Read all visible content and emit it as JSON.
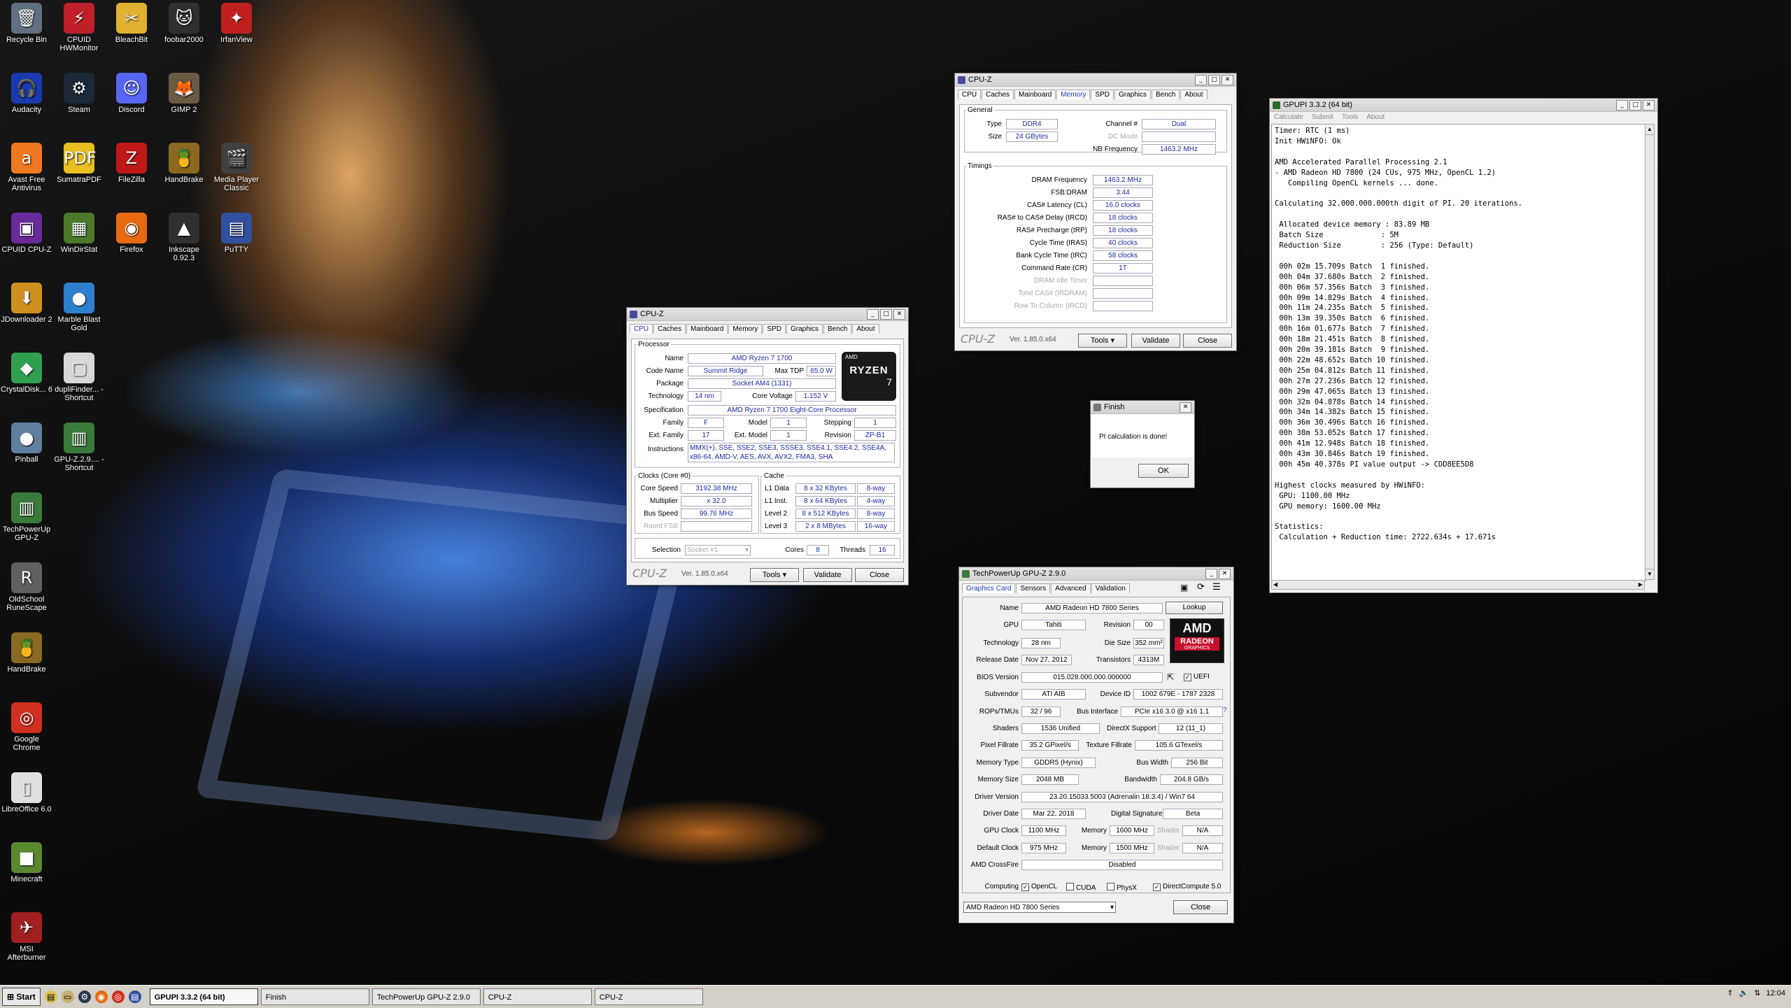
{
  "desktop_icons": [
    {
      "label": "Recycle Bin",
      "icon": "recycle-bin-icon",
      "glyph": "🗑",
      "color": "#607080"
    },
    {
      "label": "CPUID HWMonitor",
      "icon": "hwmonitor-icon",
      "glyph": "⚡",
      "color": "#c0202a"
    },
    {
      "label": "BleachBit",
      "icon": "bleachbit-icon",
      "glyph": "✂",
      "color": "#e0b030"
    },
    {
      "label": "foobar2000",
      "icon": "foobar2000-icon",
      "glyph": "🐱",
      "color": "#303030"
    },
    {
      "label": "IrfanView",
      "icon": "irfanview-icon",
      "glyph": "✦",
      "color": "#c02020"
    },
    {
      "label": "Audacity",
      "icon": "audacity-icon",
      "glyph": "🎧",
      "color": "#1a3ab0"
    },
    {
      "label": "Steam",
      "icon": "steam-icon",
      "glyph": "⚙",
      "color": "#1b2838"
    },
    {
      "label": "Discord",
      "icon": "discord-icon",
      "glyph": "☺",
      "color": "#5865f2"
    },
    {
      "label": "GIMP 2",
      "icon": "gimp-icon",
      "glyph": "🦊",
      "color": "#6b5b45"
    },
    {
      "label": "Avast Free Antivirus",
      "icon": "avast-icon",
      "glyph": "a",
      "color": "#f07820"
    },
    {
      "label": "SumatraPDF",
      "icon": "sumatrapdf-icon",
      "glyph": "PDF",
      "color": "#e8c020"
    },
    {
      "label": "FileZilla",
      "icon": "filezilla-icon",
      "glyph": "Z",
      "color": "#c01818"
    },
    {
      "label": "HandBrake",
      "icon": "handbrake-icon",
      "glyph": "🍍",
      "color": "#8a6a20"
    },
    {
      "label": "Media Player Classic",
      "icon": "mpc-icon",
      "glyph": "🎬",
      "color": "#404040"
    },
    {
      "label": "CPUID CPU-Z",
      "icon": "cpuz-icon",
      "glyph": "▣",
      "color": "#6a2a9a"
    },
    {
      "label": "WinDirStat",
      "icon": "windirstat-icon",
      "glyph": "▦",
      "color": "#4a7a2a"
    },
    {
      "label": "Firefox",
      "icon": "firefox-icon",
      "glyph": "◉",
      "color": "#e86a10"
    },
    {
      "label": "Inkscape 0.92.3",
      "icon": "inkscape-icon",
      "glyph": "▲",
      "color": "#303030"
    },
    {
      "label": "PuTTY",
      "icon": "putty-icon",
      "glyph": "▤",
      "color": "#3050a0"
    },
    {
      "label": "JDownloader 2",
      "icon": "jdownloader-icon",
      "glyph": "⬇",
      "color": "#d09020"
    },
    {
      "label": "Marble Blast Gold",
      "icon": "marble-blast-icon",
      "glyph": "●",
      "color": "#3080d0"
    },
    {
      "label": "CrystalDisk... 6",
      "icon": "crystaldisk-icon",
      "glyph": "◆",
      "color": "#30a050"
    },
    {
      "label": "dupliFinder... - Shortcut",
      "icon": "duplifinder-icon",
      "glyph": "▢",
      "color": "#d8d8d8"
    },
    {
      "label": "Pinball",
      "icon": "pinball-icon",
      "glyph": "●",
      "color": "#6080a0"
    },
    {
      "label": "GPU-Z.2.9.... - Shortcut",
      "icon": "gpuz-shortcut-icon",
      "glyph": "▥",
      "color": "#3a7a3a"
    },
    {
      "label": "TechPowerUp GPU-Z",
      "icon": "gpuz-icon",
      "glyph": "▥",
      "color": "#3a7a3a"
    },
    {
      "label": "OldSchool RuneScape",
      "icon": "runescape-icon",
      "glyph": "R",
      "color": "#606060"
    },
    {
      "label": "HandBrake",
      "icon": "handbrake-icon",
      "glyph": "🍍",
      "color": "#8a6a20"
    },
    {
      "label": "Google Chrome",
      "icon": "chrome-icon",
      "glyph": "◎",
      "color": "#d03020"
    },
    {
      "label": "LibreOffice 6.0",
      "icon": "libreoffice-icon",
      "glyph": "▯",
      "color": "#e0e0e0"
    },
    {
      "label": "Minecraft",
      "icon": "minecraft-icon",
      "glyph": "■",
      "color": "#5a8a30"
    },
    {
      "label": "MSI Afterburner",
      "icon": "afterburner-icon",
      "glyph": "✈",
      "color": "#a02020"
    }
  ],
  "cpuz_main": {
    "title": "CPU-Z",
    "tabs": [
      "CPU",
      "Caches",
      "Mainboard",
      "Memory",
      "SPD",
      "Graphics",
      "Bench",
      "About"
    ],
    "active_tab": "CPU",
    "processor_legend": "Processor",
    "labels": {
      "name": "Name",
      "code_name": "Code Name",
      "max_tdp": "Max TDP",
      "package": "Package",
      "technology": "Technology",
      "core_voltage": "Core Voltage",
      "specification": "Specification",
      "family": "Family",
      "model": "Model",
      "stepping": "Stepping",
      "ext_family": "Ext. Family",
      "ext_model": "Ext. Model",
      "revision": "Revision",
      "instructions": "Instructions",
      "clocks_legend": "Clocks (Core #0)",
      "core_speed": "Core Speed",
      "multiplier": "Multiplier",
      "bus_speed": "Bus Speed",
      "rated_fsb": "Rated FSB",
      "cache_legend": "Cache",
      "l1_data": "L1 Data",
      "l1_inst": "L1 Inst.",
      "level2": "Level 2",
      "level3": "Level 3",
      "selection": "Selection",
      "cores": "Cores",
      "threads": "Threads"
    },
    "name": "AMD Ryzen 7 1700",
    "code_name": "Summit Ridge",
    "max_tdp": "65.0 W",
    "package": "Socket AM4 (1331)",
    "technology": "14 nm",
    "core_voltage": "1.152 V",
    "specification": "AMD Ryzen 7 1700 Eight-Core Processor",
    "family": "F",
    "model": "1",
    "stepping": "1",
    "ext_family": "17",
    "ext_model": "1",
    "revision": "ZP-B1",
    "instructions": "MMX(+), SSE, SSE2, SSE3, SSSE3, SSE4.1, SSE4.2, SSE4A, x86-64, AMD-V, AES, AVX, AVX2, FMA3, SHA",
    "core_speed": "3192.38 MHz",
    "multiplier": "x 32.0",
    "bus_speed": "99.76 MHz",
    "rated_fsb": "",
    "l1_data": "8 x 32 KBytes",
    "l1_data_way": "8-way",
    "l1_inst": "8 x 64 KBytes",
    "l1_inst_way": "4-way",
    "level2": "8 x 512 KBytes",
    "level2_way": "8-way",
    "level3": "2 x 8 MBytes",
    "level3_way": "16-way",
    "selection": "Socket #1",
    "cores": "8",
    "threads": "16",
    "logo_text": "CPU-Z",
    "version": "Ver. 1.85.0.x64",
    "tools": "Tools",
    "validate": "Validate",
    "close": "Close",
    "ryzen_badge": {
      "brand": "AMD",
      "name": "RYZEN",
      "tier": "7"
    }
  },
  "cpuz_memory": {
    "title": "CPU-Z",
    "tabs": [
      "CPU",
      "Caches",
      "Mainboard",
      "Memory",
      "SPD",
      "Graphics",
      "Bench",
      "About"
    ],
    "active_tab": "Memory",
    "general_legend": "General",
    "timings_legend": "Timings",
    "labels": {
      "type": "Type",
      "size": "Size",
      "channel": "Channel #",
      "dc_mode": "DC Mode",
      "nb_freq": "NB Frequency",
      "dram_freq": "DRAM Frequency",
      "fsb_dram": "FSB:DRAM",
      "cas": "CAS# Latency (CL)",
      "rcd": "RAS# to CAS# Delay (tRCD)",
      "rp": "RAS# Precharge (tRP)",
      "ras": "Cycle Time (tRAS)",
      "rc": "Bank Cycle Time (tRC)",
      "cr": "Command Rate (CR)",
      "idle": "DRAM Idle Timer",
      "rdram": "Total CAS# (tRDRAM)",
      "rcd2": "Row To Column (tRCD)"
    },
    "type": "DDR4",
    "size": "24 GBytes",
    "channel": "Dual",
    "dc_mode": "",
    "nb_freq": "1463.2 MHz",
    "dram_freq": "1463.2 MHz",
    "fsb_dram": "3:44",
    "cas": "16.0 clocks",
    "rcd": "18 clocks",
    "rp": "18 clocks",
    "ras": "40 clocks",
    "rc": "58 clocks",
    "cr": "1T",
    "logo_text": "CPU-Z",
    "version": "Ver. 1.85.0.x64",
    "tools": "Tools",
    "validate": "Validate",
    "close": "Close"
  },
  "finish_dialog": {
    "title": "Finish",
    "message": "PI calculation is done!",
    "ok": "OK"
  },
  "gpupi": {
    "title": "GPUPI 3.3.2 (64 bit)",
    "menu": [
      "Calculate",
      "Submit",
      "Tools",
      "About"
    ],
    "output": "Timer: RTC (1 ms)\nInit HWiNFO: Ok\n\nAMD Accelerated Parallel Processing 2.1\n- AMD Radeon HD 7800 (24 CUs, 975 MHz, OpenCL 1.2)\n   Compiling OpenCL kernels ... done.\n\nCalculating 32.000.000.000th digit of PI. 20 iterations.\n\n Allocated device memory : 83.89 MB\n Batch Size             : 5M\n Reduction Size         : 256 (Type: Default)\n\n 00h 02m 15.709s Batch  1 finished.\n 00h 04m 37.680s Batch  2 finished.\n 00h 06m 57.356s Batch  3 finished.\n 00h 09m 14.829s Batch  4 finished.\n 00h 11m 24.235s Batch  5 finished.\n 00h 13m 39.350s Batch  6 finished.\n 00h 16m 01.677s Batch  7 finished.\n 00h 18m 21.451s Batch  8 finished.\n 00h 20m 39.181s Batch  9 finished.\n 00h 22m 48.652s Batch 10 finished.\n 00h 25m 04.812s Batch 11 finished.\n 00h 27m 27.236s Batch 12 finished.\n 00h 29m 47.065s Batch 13 finished.\n 00h 32m 04.878s Batch 14 finished.\n 00h 34m 14.382s Batch 15 finished.\n 00h 36m 30.496s Batch 16 finished.\n 00h 38m 53.052s Batch 17 finished.\n 00h 41m 12.948s Batch 18 finished.\n 00h 43m 30.846s Batch 19 finished.\n 00h 45m 40.378s PI value output -> CDD8EE5D8\n\nHighest clocks measured by HWiNFO:\n GPU: 1100.00 MHz\n GPU memory: 1600.00 MHz\n\nStatistics:\n Calculation + Reduction time: 2722.634s + 17.671s"
  },
  "gpuz": {
    "title": "TechPowerUp GPU-Z 2.9.0",
    "tabs": [
      "Graphics Card",
      "Sensors",
      "Advanced",
      "Validation"
    ],
    "active_tab": "Graphics Card",
    "labels": {
      "name": "Name",
      "gpu": "GPU",
      "revision": "Revision",
      "technology": "Technology",
      "die_size": "Die Size",
      "release_date": "Release Date",
      "transistors": "Transistors",
      "bios_version": "BIOS Version",
      "uefi": "UEFI",
      "subvendor": "Subvendor",
      "device_id": "Device ID",
      "rops_tmus": "ROPs/TMUs",
      "bus_interface": "Bus Interface",
      "shaders": "Shaders",
      "directx": "DirectX Support",
      "pixel_fillrate": "Pixel Fillrate",
      "texture_fillrate": "Texture Fillrate",
      "memory_type": "Memory Type",
      "bus_width": "Bus Width",
      "memory_size": "Memory Size",
      "bandwidth": "Bandwidth",
      "driver_version": "Driver Version",
      "driver_date": "Driver Date",
      "digital_signature": "Digital Signature",
      "gpu_clock": "GPU Clock",
      "memory": "Memory",
      "shader": "Shader",
      "default_clock": "Default Clock",
      "crossfire": "AMD CrossFire",
      "computing": "Computing"
    },
    "name": "AMD Radeon HD 7800 Series",
    "lookup": "Lookup",
    "gpu": "Tahiti",
    "revision": "00",
    "technology": "28 nm",
    "die_size": "352 mm²",
    "release_date": "Nov 27, 2012",
    "transistors": "4313M",
    "bios_version": "015.028.000.000.000000",
    "subvendor": "ATI AIB",
    "device_id": "1002 679E - 1787 2328",
    "rops_tmus": "32 / 96",
    "bus_interface": "PCIe x16 3.0 @ x16 1.1",
    "shaders": "1536 Unified",
    "directx": "12 (11_1)",
    "pixel_fillrate": "35.2 GPixel/s",
    "texture_fillrate": "105.6 GTexel/s",
    "memory_type": "GDDR5 (Hynix)",
    "bus_width": "256 Bit",
    "memory_size": "2048 MB",
    "bandwidth": "204.8 GB/s",
    "driver_version": "23.20.15033.5003 (Adrenalin 18.3.4) / Win7 64",
    "driver_date": "Mar 22, 2018",
    "digital_signature": "Beta",
    "gpu_clock": "1100 MHz",
    "gpu_memory": "1600 MHz",
    "gpu_shader": "N/A",
    "default_clock": "975 MHz",
    "default_memory": "1500 MHz",
    "default_shader": "N/A",
    "crossfire": "Disabled",
    "computing": [
      {
        "label": "OpenCL",
        "checked": true
      },
      {
        "label": "CUDA",
        "checked": false
      },
      {
        "label": "PhysX",
        "checked": false
      },
      {
        "label": "DirectCompute 5.0",
        "checked": true
      }
    ],
    "selected_card": "AMD Radeon HD 7800 Series",
    "close": "Close",
    "amd_logo": {
      "brand": "AMD",
      "product": "RADEON",
      "sub": "GRAPHICS"
    }
  },
  "taskbar": {
    "start": "Start",
    "tasks": [
      {
        "label": "GPUPI 3.3.2 (64 bit)",
        "active": true
      },
      {
        "label": "Finish",
        "active": false
      },
      {
        "label": "TechPowerUp GPU-Z 2.9.0",
        "active": false
      },
      {
        "label": "CPU-Z",
        "active": false
      },
      {
        "label": "CPU-Z",
        "active": false
      }
    ],
    "clock": "12:04"
  },
  "colors": {
    "value_text": "#1e2aa0",
    "amd_red": "#c8102e",
    "titlebar": "#d8d8d8"
  }
}
